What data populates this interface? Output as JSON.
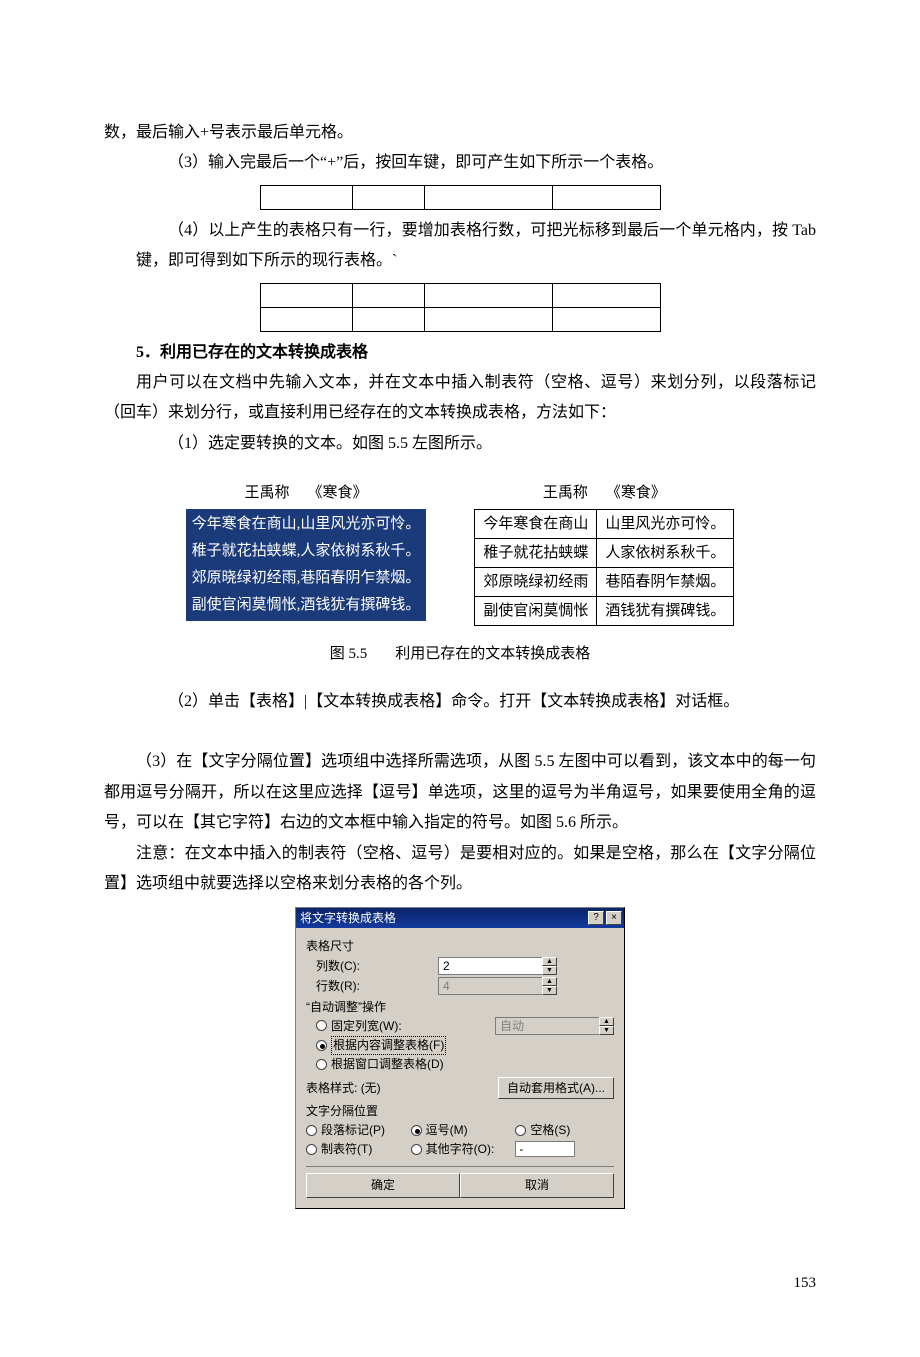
{
  "body": {
    "p1": "数，最后输入+号表示最后单元格。",
    "p2": "（3）输入完最后一个“+”后，按回车键，即可产生如下所示一个表格。",
    "p3": "（4）以上产生的表格只有一行，要增加表格行数，可把光标移到最后一个单元格内，按 Tab 键，即可得到如下所示的现行表格。`",
    "h5": "5．利用已存在的文本转换成表格",
    "p4": "用户可以在文档中先输入文本，并在文本中插入制表符（空格、逗号）来划分列，以段落标记（回车）来划分行，或直接利用已经存在的文本转换成表格，方法如下：",
    "p5": "（1）选定要转换的文本。如图 5.5 左图所示。",
    "p6": "（2）单击【表格】|【文本转换成表格】命令。打开【文本转换成表格】对话框。",
    "p7": "（3）在【文字分隔位置】选项组中选择所需选项，从图 5.5 左图中可以看到，该文本中的每一句都用逗号分隔开，所以在这里应选择【逗号】单选项，这里的逗号为半角逗号，如果要使用全角的逗号，可以在【其它字符】右边的文本框中输入指定的符号。如图 5.6 所示。",
    "p8": "注意：在文本中插入的制表符（空格、逗号）是要相对应的。如果是空格，那么在【文字分隔位置】选项组中就要选择以空格来划分表格的各个列。"
  },
  "fig55": {
    "title_author": "王禹称",
    "title_work": "《寒食》",
    "caption_id": "图 5.5",
    "caption_text": "利用已存在的文本转换成表格",
    "lines": [
      "今年寒食在商山,山里风光亦可怜。",
      "稚子就花拈蛱蝶,人家依树系秋千。",
      "郊原晓绿初经雨,巷陌春阴乍禁烟。",
      "副使官闲莫惆怅,酒钱犹有撰碑钱。"
    ],
    "cells": [
      [
        "今年寒食在商山",
        "山里风光亦可怜。"
      ],
      [
        "稚子就花拈蛱蝶",
        "人家依树系秋千。"
      ],
      [
        "郊原晓绿初经雨",
        "巷陌春阴乍禁烟。"
      ],
      [
        "副使官闲莫惆怅",
        "酒钱犹有撰碑钱。"
      ]
    ]
  },
  "dialog": {
    "title": "将文字转换成表格",
    "table_size_label": "表格尺寸",
    "cols_label": "列数(C):",
    "cols_value": "2",
    "rows_label": "行数(R):",
    "rows_value": "4",
    "autofit_label": "“自动调整”操作",
    "fixed_width_label": "固定列宽(W):",
    "fixed_width_value": "自动",
    "fit_content_label": "根据内容调整表格(F)",
    "fit_window_label": "根据窗口调整表格(D)",
    "style_prefix": "表格样式:",
    "style_value": "(无)",
    "autoformat_btn": "自动套用格式(A)...",
    "sep_label": "文字分隔位置",
    "sep_para": "段落标记(P)",
    "sep_comma": "逗号(M)",
    "sep_space": "空格(S)",
    "sep_tab": "制表符(T)",
    "sep_other": "其他字符(O):",
    "sep_other_value": "-",
    "ok": "确定",
    "cancel": "取消"
  },
  "page_number": "153"
}
